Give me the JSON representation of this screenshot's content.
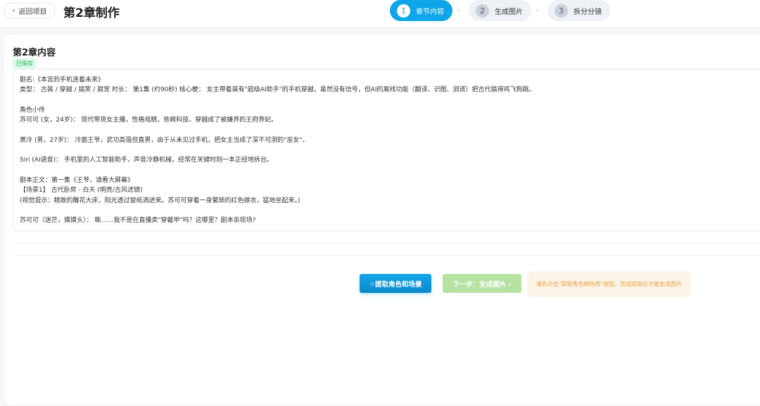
{
  "header": {
    "back_label": "返回项目",
    "title": "第2章制作",
    "steps": [
      {
        "num": "1",
        "label": "章节内容"
      },
      {
        "num": "2",
        "label": "生成图片"
      },
      {
        "num": "3",
        "label": "拆分分镜"
      }
    ]
  },
  "card": {
    "title": "第2章内容",
    "saved_badge": "已保存",
    "content": "剧名:《本宫的手机连着未来》\n类型： 古装 / 穿越 / 搞笑 / 甜宠 时长： 第1集 (约90秒) 核心梗： 女主带着装有\"超级AI助手\"的手机穿越，虽然没有信号，但AI的离线功能（翻译、识图、测谎）把古代搞得鸡飞狗跳。\n\n角色小传\n苏可可 (女，24岁)： 现代带货女主播，性格戏精，依赖科技。穿越成了被嫌弃的王府弃妃。\n\n萧冷 (男，27岁)： 冷面王爷，武功高强但直男，由于从未见过手机，把女主当成了深不可测的\"巫女\"。\n\nSiri (AI语音)： 手机里的人工智能助手，声音冷静机械，经常在关键时刻一本正经地拆台。\n\n剧本正文：第一集《王爷，请看大屏幕》\n【场景1】 古代卧房 - 白天 (明亮/古风滤镜)\n(视觉提示：精致的雕花大床，阳光透过窗纸洒进来。苏可可穿着一身繁琐的红色嫁衣，猛地坐起来。)\n\n苏可可（迷茫，摸摸头）： 嘶……我不是在直播卖\"穿戴甲\"吗？这哪里？剧本杀现场?"
  },
  "actions": {
    "extract_label": "☆提取角色和场景",
    "next_label": "下一步：生成图片 ›",
    "hint": "请先点击\"提取角色和场景\"按钮，完成提取后才能生成图片"
  }
}
